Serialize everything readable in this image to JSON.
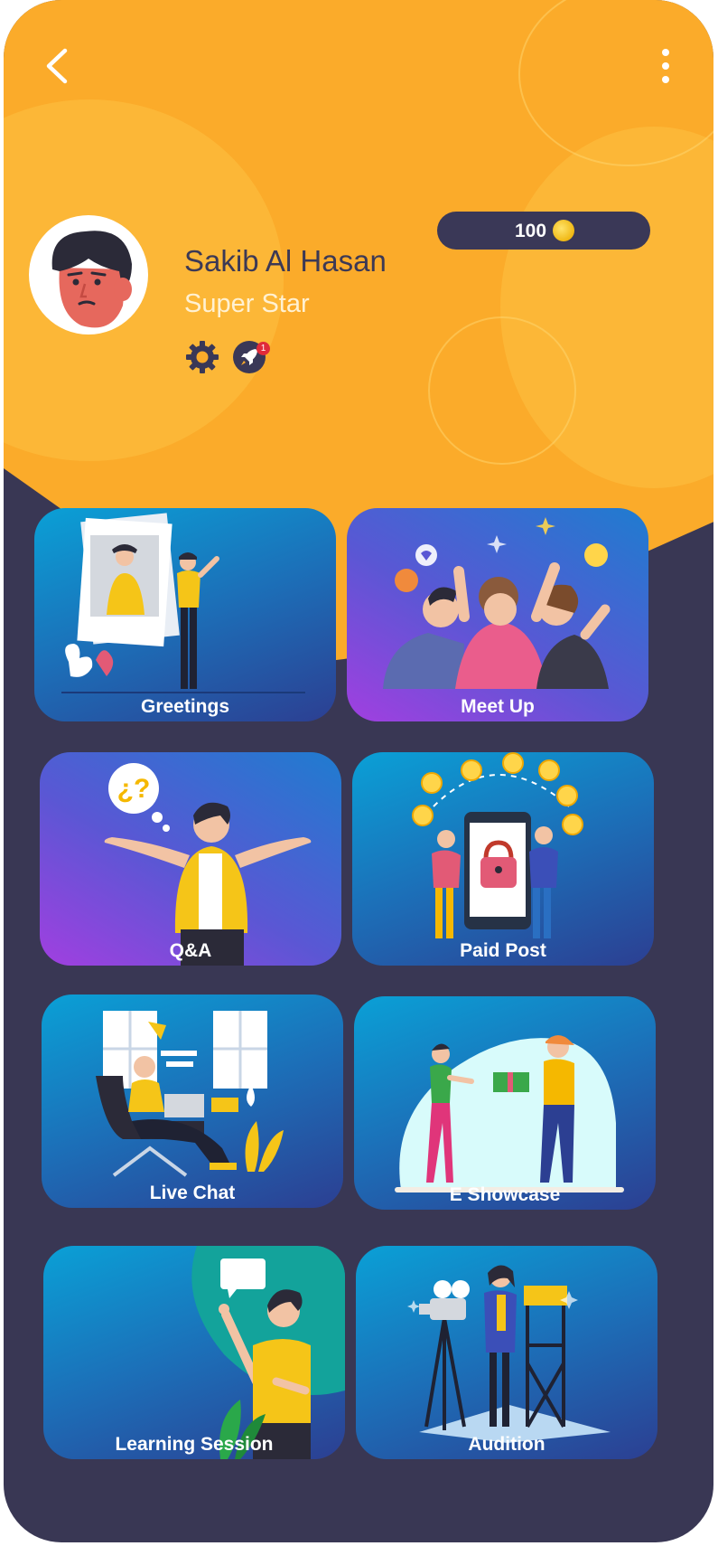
{
  "header": {
    "back_icon": "chevron-left-icon",
    "menu_icon": "more-vertical-icon"
  },
  "profile": {
    "name": "Sakib Al Hasan",
    "role": "Super Star",
    "settings_icon": "gear-icon",
    "notifications_icon": "rocket-icon",
    "notification_count": "1"
  },
  "wallet": {
    "coins": "100",
    "coin_icon": "coin-icon"
  },
  "colors": {
    "header_orange": "#fbab2a",
    "body_navy": "#393754",
    "text_dark": "#3c3955",
    "badge_red": "#e02a3a"
  },
  "cards": [
    {
      "label": "Greetings"
    },
    {
      "label": "Meet Up"
    },
    {
      "label": "Q&A"
    },
    {
      "label": "Paid Post"
    },
    {
      "label": "Live Chat"
    },
    {
      "label": "E Showcase"
    },
    {
      "label": "Learning Session"
    },
    {
      "label": "Audition"
    }
  ]
}
